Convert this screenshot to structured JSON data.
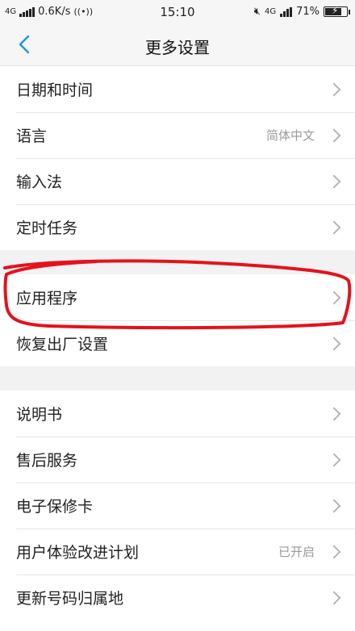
{
  "status": {
    "network_type": "4G",
    "speed": "0.6K/s",
    "time": "15:10",
    "network_type_right": "4G",
    "battery": "71%"
  },
  "header": {
    "title": "更多设置"
  },
  "groups": [
    {
      "items": [
        {
          "label": "日期和时间",
          "value": ""
        },
        {
          "label": "语言",
          "value": "简体中文"
        },
        {
          "label": "输入法",
          "value": ""
        },
        {
          "label": "定时任务",
          "value": ""
        }
      ]
    },
    {
      "items": [
        {
          "label": "应用程序",
          "value": ""
        },
        {
          "label": "恢复出厂设置",
          "value": ""
        }
      ]
    },
    {
      "items": [
        {
          "label": "说明书",
          "value": ""
        },
        {
          "label": "售后服务",
          "value": ""
        },
        {
          "label": "电子保修卡",
          "value": ""
        },
        {
          "label": "用户体验改进计划",
          "value": "已开启"
        },
        {
          "label": "更新号码归属地",
          "value": ""
        }
      ]
    }
  ],
  "colors": {
    "accent": "#1a9ad6",
    "annotation": "#e5121b"
  }
}
